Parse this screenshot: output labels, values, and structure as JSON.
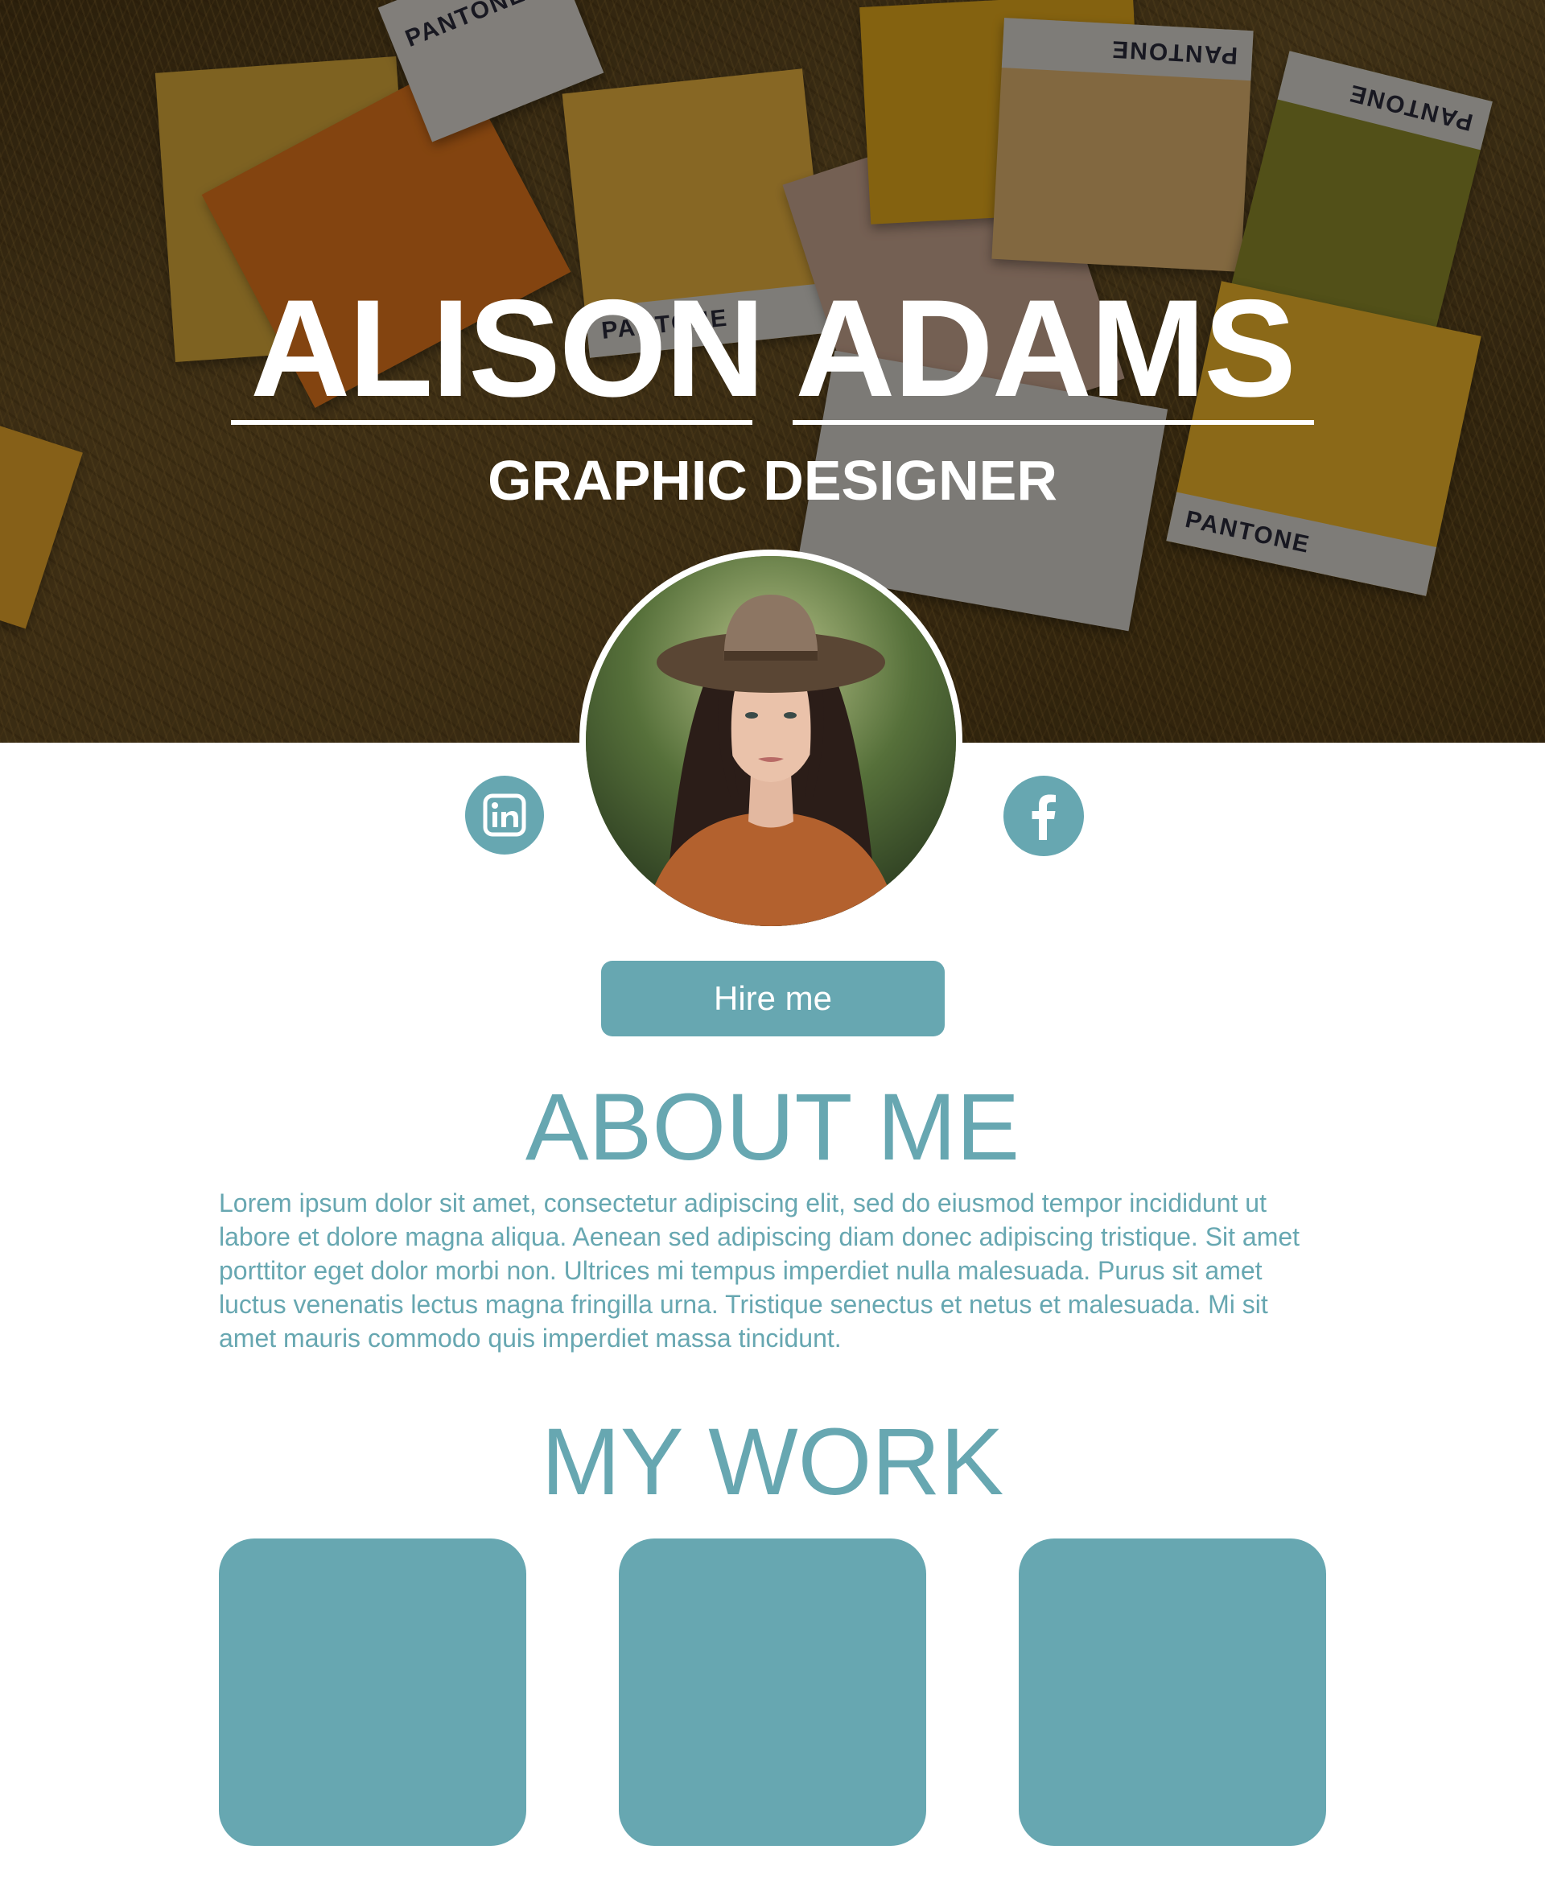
{
  "hero": {
    "name": "ALISON ADAMS",
    "role": "GRAPHIC DESIGNER",
    "photo_swatch_labels": [
      "PANTONE",
      "PANTONE",
      "PANTONE",
      "PANTONE",
      "PANTONE"
    ]
  },
  "social": {
    "linkedin_icon": "linkedin-icon",
    "facebook_icon": "facebook-icon"
  },
  "cta": {
    "hire_label": "Hire me"
  },
  "about": {
    "title": "ABOUT ME",
    "body": "Lorem ipsum dolor sit amet, consectetur adipiscing elit, sed do eiusmod tempor incididunt ut labore et dolore magna aliqua. Aenean sed adipiscing diam donec adipiscing tristique. Sit amet porttitor eget dolor morbi non. Ultrices mi tempus imperdiet nulla malesuada. Purus sit amet luctus venenatis lectus magna fringilla urna. Tristique senectus et netus et malesuada. Mi sit amet mauris commodo quis imperdiet massa tincidunt."
  },
  "work": {
    "title": "MY WORK",
    "items_count": 3
  },
  "colors": {
    "accent": "#67a7b1",
    "white": "#ffffff"
  }
}
